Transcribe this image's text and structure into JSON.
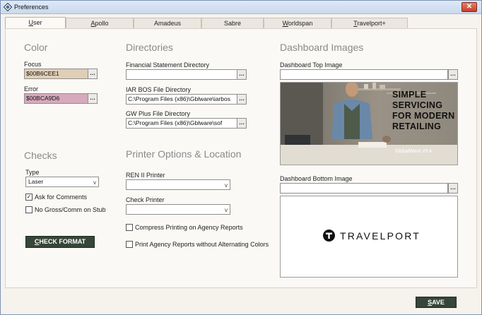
{
  "window": {
    "title": "Preferences",
    "icon": "preferences-app-icon"
  },
  "tabs": [
    {
      "label": "User",
      "accel": "U",
      "rest": "ser",
      "active": true
    },
    {
      "label": "Apollo",
      "accel": "A",
      "rest": "pollo",
      "active": false
    },
    {
      "label": "Amadeus",
      "accel": "",
      "rest": "Amadeus",
      "active": false
    },
    {
      "label": "Sabre",
      "accel": "",
      "rest": "Sabre",
      "active": false
    },
    {
      "label": "Worldspan",
      "accel": "W",
      "rest": "orldspan",
      "active": false
    },
    {
      "label": "Travelport+",
      "accel": "T",
      "rest": "ravelport+",
      "active": false
    }
  ],
  "color": {
    "heading": "Color",
    "focus_label": "Focus",
    "focus_value": "$00B6CEE1",
    "focus_swatch": "#e1ceb6",
    "error_label": "Error",
    "error_value": "$00BCA9D6",
    "error_swatch": "#d6a9bc"
  },
  "directories": {
    "heading": "Directories",
    "fin_label": "Financial Statement Directory",
    "fin_value": "",
    "iar_label": "IAR BOS File Directory",
    "iar_value": "C:\\Program Files (x86)\\Gblware\\iarbos",
    "gw_label": "GW Plus File Directory",
    "gw_value": "C:\\Program Files (x86)\\Gblware\\sof"
  },
  "dashboard": {
    "heading": "Dashboard Images",
    "top_label": "Dashboard Top Image",
    "top_value": "",
    "top_image_text_1": "SIMPLE",
    "top_image_text_2": "SERVICING",
    "top_image_text_3": "FOR MODERN",
    "top_image_text_4": "RETAILING",
    "top_image_brand": "GlobalWare v9.4",
    "bottom_label": "Dashboard Bottom Image",
    "bottom_value": "",
    "bottom_logo_text": "TRAVELPORT"
  },
  "checks": {
    "heading": "Checks",
    "type_label": "Type",
    "type_value": "Laser",
    "ask_comments_label": "Ask for Comments",
    "ask_comments_checked": true,
    "no_gross_label": "No Gross/Comm on Stub",
    "no_gross_checked": false,
    "check_format_accel": "C",
    "check_format_rest": "HECK FORMAT"
  },
  "printer": {
    "heading": "Printer Options & Location",
    "ren_label": "REN II Printer",
    "ren_value": "",
    "check_printer_label": "Check Printer",
    "check_printer_value": "",
    "compress_label": "Compress Printing on Agency Reports",
    "compress_checked": false,
    "no_alt_label": "Print Agency Reports without Alternating Colors",
    "no_alt_checked": false
  },
  "footer": {
    "save_accel": "S",
    "save_rest": "AVE"
  },
  "icons": {
    "ellipsis": "…",
    "dropdown": "v",
    "check": "✓",
    "close": "✕"
  }
}
